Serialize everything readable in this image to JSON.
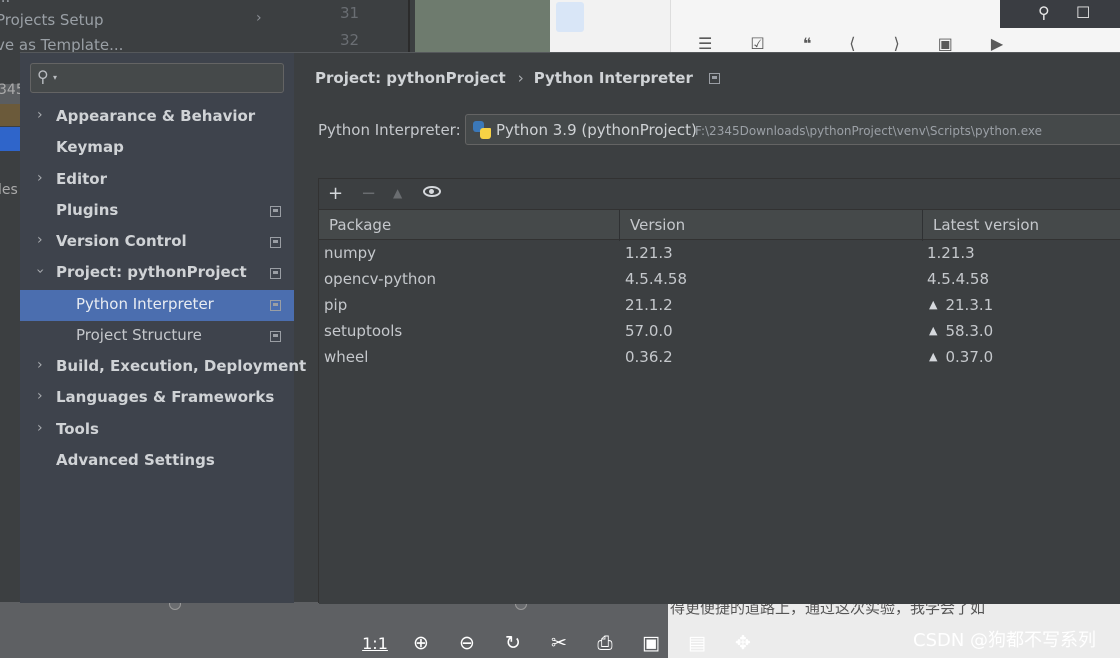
{
  "background": {
    "behind_text": [
      "Projects Setup",
      "ve as Template..."
    ],
    "line_numbers": [
      "31",
      "32"
    ],
    "left_strip_texts": [
      "345",
      "les"
    ],
    "bottom_text": "得更便捷的道路上，通过这次实验，我学会了如",
    "viewer_toolbar": [
      "1:1",
      "⊕",
      "⊖",
      "↻",
      "✂",
      "⎙",
      "▣",
      "▤",
      "✥"
    ],
    "watermark": "CSDN @狗都不写系列",
    "title_bar_icons": [
      "pin-icon",
      "maximize-icon"
    ]
  },
  "dialog": {
    "search": {
      "value": "",
      "placeholder": ""
    },
    "nav": [
      {
        "label": "Appearance & Behavior",
        "expandable": true,
        "expanded": false,
        "project_scoped": false
      },
      {
        "label": "Keymap",
        "expandable": false,
        "project_scoped": false
      },
      {
        "label": "Editor",
        "expandable": true,
        "expanded": false,
        "project_scoped": false
      },
      {
        "label": "Plugins",
        "expandable": false,
        "project_scoped": true
      },
      {
        "label": "Version Control",
        "expandable": true,
        "expanded": false,
        "project_scoped": true
      },
      {
        "label": "Project: pythonProject",
        "expandable": true,
        "expanded": true,
        "project_scoped": true
      },
      {
        "label": "Python Interpreter",
        "sub": true,
        "selected": true,
        "project_scoped": true
      },
      {
        "label": "Project Structure",
        "sub": true,
        "project_scoped": true
      },
      {
        "label": "Build, Execution, Deployment",
        "expandable": true,
        "expanded": false,
        "project_scoped": false
      },
      {
        "label": "Languages & Frameworks",
        "expandable": true,
        "expanded": false,
        "project_scoped": false
      },
      {
        "label": "Tools",
        "expandable": true,
        "expanded": false,
        "project_scoped": false
      },
      {
        "label": "Advanced Settings",
        "expandable": false,
        "project_scoped": false
      }
    ],
    "breadcrumb": {
      "parent": "Project: pythonProject",
      "current": "Python Interpreter"
    },
    "interpreter": {
      "label": "Python Interpreter:",
      "name": "Python 3.9 (pythonProject)",
      "path": "F:\\2345Downloads\\pythonProject\\venv\\Scripts\\python.exe"
    },
    "packages": {
      "toolbar": [
        "plus-icon",
        "minus-icon",
        "upgrade-icon",
        "eye-icon"
      ],
      "columns": [
        "Package",
        "Version",
        "Latest version"
      ],
      "rows": [
        {
          "package": "numpy",
          "version": "1.21.3",
          "latest": "1.21.3",
          "upgrade": false
        },
        {
          "package": "opencv-python",
          "version": "4.5.4.58",
          "latest": "4.5.4.58",
          "upgrade": false
        },
        {
          "package": "pip",
          "version": "21.1.2",
          "latest": "21.3.1",
          "upgrade": true
        },
        {
          "package": "setuptools",
          "version": "57.0.0",
          "latest": "58.3.0",
          "upgrade": true
        },
        {
          "package": "wheel",
          "version": "0.36.2",
          "latest": "0.37.0",
          "upgrade": true
        }
      ]
    },
    "colors": {
      "selection": "#4b6eaf",
      "panel": "#3c3f41",
      "sidebar": "#3e434c"
    }
  }
}
